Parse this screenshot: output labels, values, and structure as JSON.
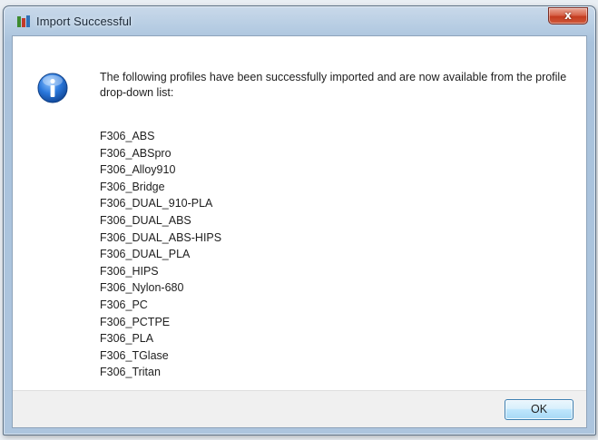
{
  "window": {
    "title": "Import Successful",
    "close_label": "x"
  },
  "icons": {
    "app": "app-icon",
    "info": "info-icon",
    "close": "close-icon"
  },
  "colors": {
    "info_icon": "#1e6ad0",
    "close_button": "#c94b2f",
    "ok_button_border": "#3c7fb1"
  },
  "dialog": {
    "message": "The following profiles have been successfully imported and are now available from the profile drop-down list:",
    "profiles": [
      "F306_ABS",
      "F306_ABSpro",
      "F306_Alloy910",
      "F306_Bridge",
      "F306_DUAL_910-PLA",
      "F306_DUAL_ABS",
      "F306_DUAL_ABS-HIPS",
      "F306_DUAL_PLA",
      "F306_HIPS",
      "F306_Nylon-680",
      "F306_PC",
      "F306_PCTPE",
      "F306_PLA",
      "F306_TGlase",
      "F306_Tritan"
    ]
  },
  "buttons": {
    "ok_label": "OK"
  }
}
